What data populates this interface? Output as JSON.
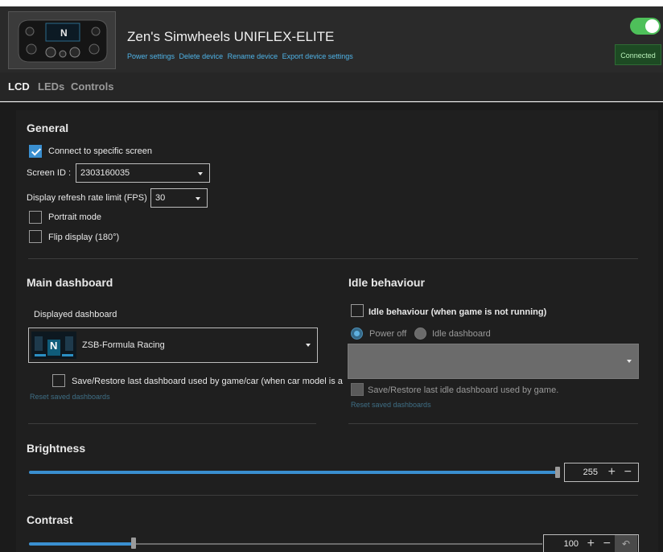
{
  "device": {
    "title": "Zen's Simwheels UNIFLEX-ELITE",
    "links": [
      "Power settings",
      "Delete device",
      "Rename device",
      "Export device settings"
    ],
    "connected": true,
    "status": "Connected"
  },
  "tabs": [
    {
      "label": "LCD",
      "active": true
    },
    {
      "label": "LEDs",
      "active": false
    },
    {
      "label": "Controls",
      "active": false
    }
  ],
  "general": {
    "heading": "General",
    "connect_label": "Connect to specific screen",
    "connect_checked": true,
    "screen_id_label": "Screen ID :",
    "screen_id_value": "2303160035",
    "refresh_label": "Display refresh rate limit (FPS)",
    "refresh_value": "30",
    "portrait_label": "Portrait mode",
    "portrait_checked": false,
    "flip_label": "Flip display (180°)",
    "flip_checked": false
  },
  "main_dashboard": {
    "heading": "Main dashboard",
    "displayed_label": "Displayed dashboard",
    "dashboard_name": "ZSB-Formula Racing",
    "save_restore_label": "Save/Restore last dashboard used by game/car (when car model is a",
    "save_restore_checked": false,
    "reset_link": "Reset saved dashboards"
  },
  "idle": {
    "heading": "Idle behaviour",
    "enable_label": "Idle behaviour (when game is not running)",
    "enable_checked": false,
    "option_power_off": "Power off",
    "option_idle_dashboard": "Idle dashboard",
    "selected_option": "Power off",
    "save_restore_label": "Save/Restore last idle dashboard used by game.",
    "reset_link": "Reset saved dashboards"
  },
  "brightness": {
    "heading": "Brightness",
    "value": "255",
    "fraction": 1.0
  },
  "contrast": {
    "heading": "Contrast",
    "value": "100",
    "fraction": 0.2
  },
  "colors": {
    "accent": "#3a8fd0",
    "link": "#4fb4e8",
    "connected_bg": "#1d4a23",
    "toggle_on": "#4ec05a"
  }
}
